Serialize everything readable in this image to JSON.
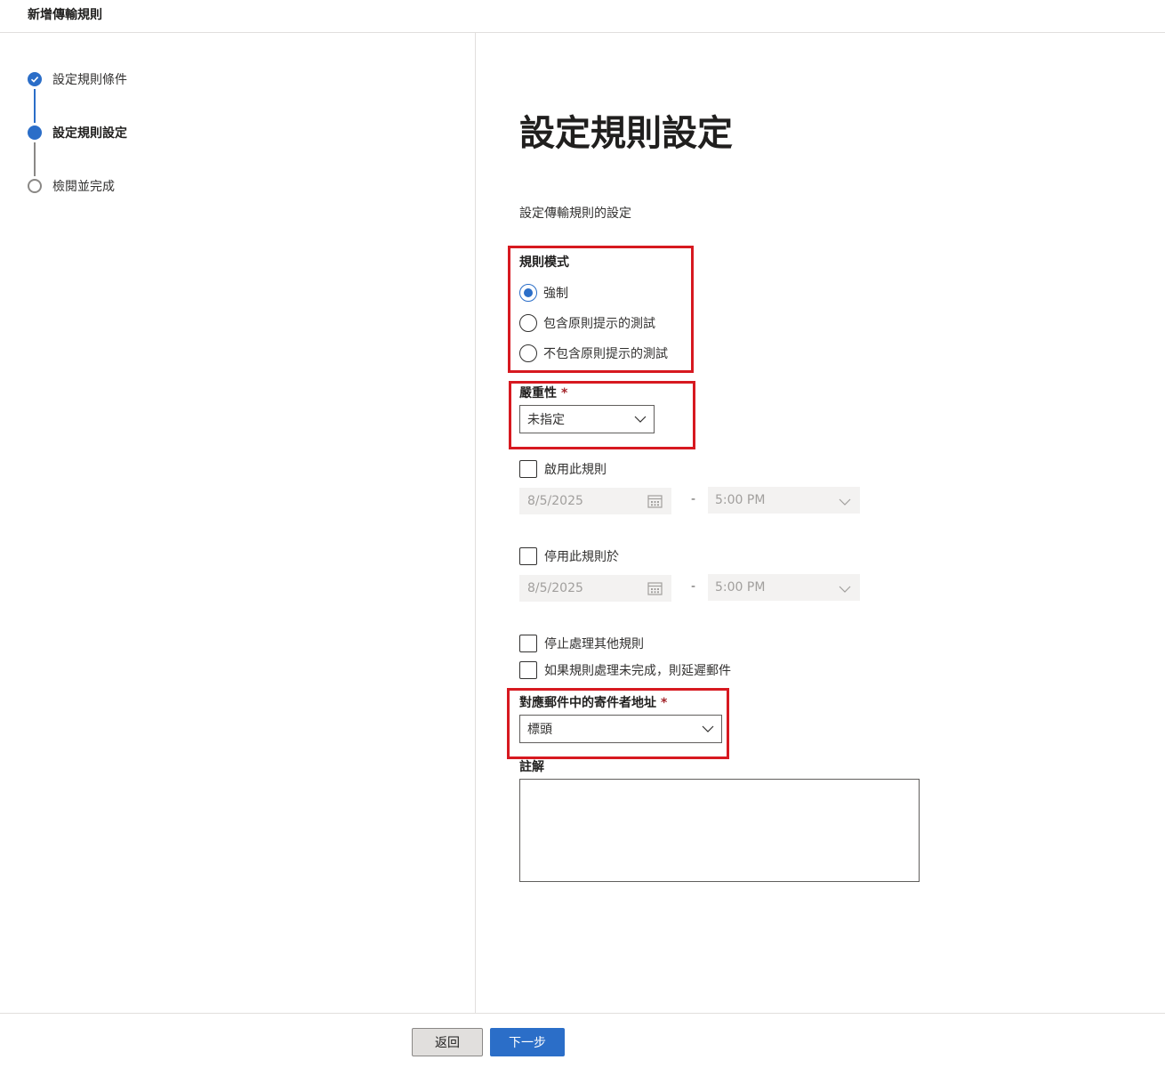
{
  "header": {
    "title": "新增傳輸規則"
  },
  "steps": [
    {
      "label": "設定規則條件",
      "state": "done"
    },
    {
      "label": "設定規則設定",
      "state": "current"
    },
    {
      "label": "檢閱並完成",
      "state": "todo"
    }
  ],
  "main": {
    "title": "設定規則設定",
    "description": "設定傳輸規則的設定",
    "rule_mode": {
      "label": "規則模式",
      "options": [
        "強制",
        "包含原則提示的測試",
        "不包含原則提示的測試"
      ],
      "selected": "強制"
    },
    "severity": {
      "label": "嚴重性",
      "required_mark": "*",
      "value": "未指定"
    },
    "activate": {
      "label": "啟用此規則",
      "date": "8/5/2025",
      "separator": "-",
      "time": "5:00 PM"
    },
    "deactivate": {
      "label": "停用此規則於",
      "date": "8/5/2025",
      "separator": "-",
      "time": "5:00 PM"
    },
    "stop_processing": {
      "label": "停止處理其他規則"
    },
    "defer_message": {
      "label": "如果規則處理未完成，則延遲郵件"
    },
    "match_sender": {
      "label": "對應郵件中的寄件者地址",
      "required_mark": "*",
      "value": "標頭"
    },
    "comments": {
      "label": "註解",
      "value": ""
    }
  },
  "footer": {
    "back_label": "返回",
    "next_label": "下一步"
  },
  "colors": {
    "accent": "#2b6ec8",
    "highlight": "#d71920",
    "required": "#a4262c"
  }
}
